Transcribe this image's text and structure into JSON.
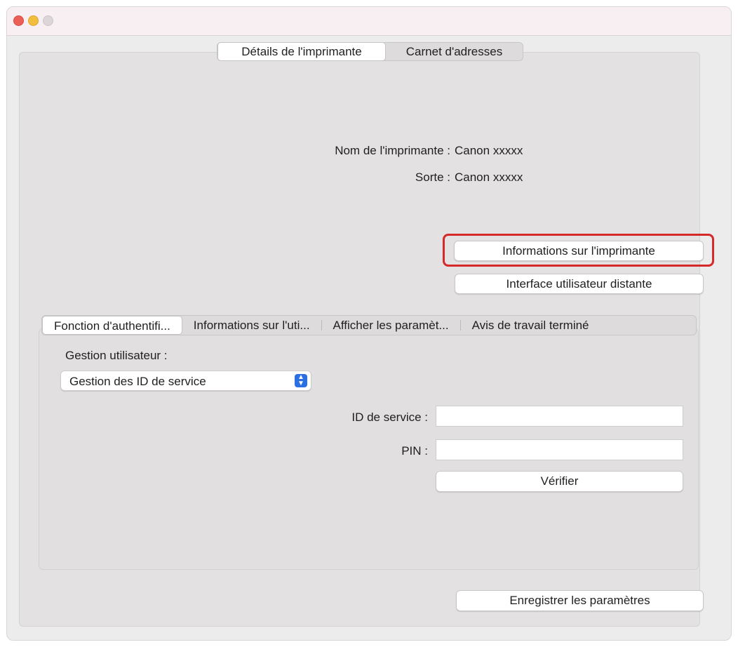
{
  "top_tabs": [
    "Détails de l'imprimante",
    "Carnet d'adresses"
  ],
  "printer_info": {
    "name_label": "Nom de l'imprimante :",
    "name_value": "Canon xxxxx",
    "type_label": "Sorte :",
    "type_value": "Canon xxxxx"
  },
  "buttons": {
    "printer_info": "Informations sur l'imprimante",
    "remote_ui": "Interface utilisateur distante",
    "verify": "Vérifier",
    "save": "Enregistrer les paramètres"
  },
  "sub_tabs": [
    "Fonction d'authentifi...",
    "Informations sur l'uti...",
    "Afficher les paramèt...",
    "Avis de travail terminé"
  ],
  "user_management": {
    "label": "Gestion utilisateur :",
    "selected": "Gestion des ID de service",
    "service_id_label": "ID de service :",
    "service_id_value": "",
    "pin_label": "PIN :",
    "pin_value": ""
  }
}
